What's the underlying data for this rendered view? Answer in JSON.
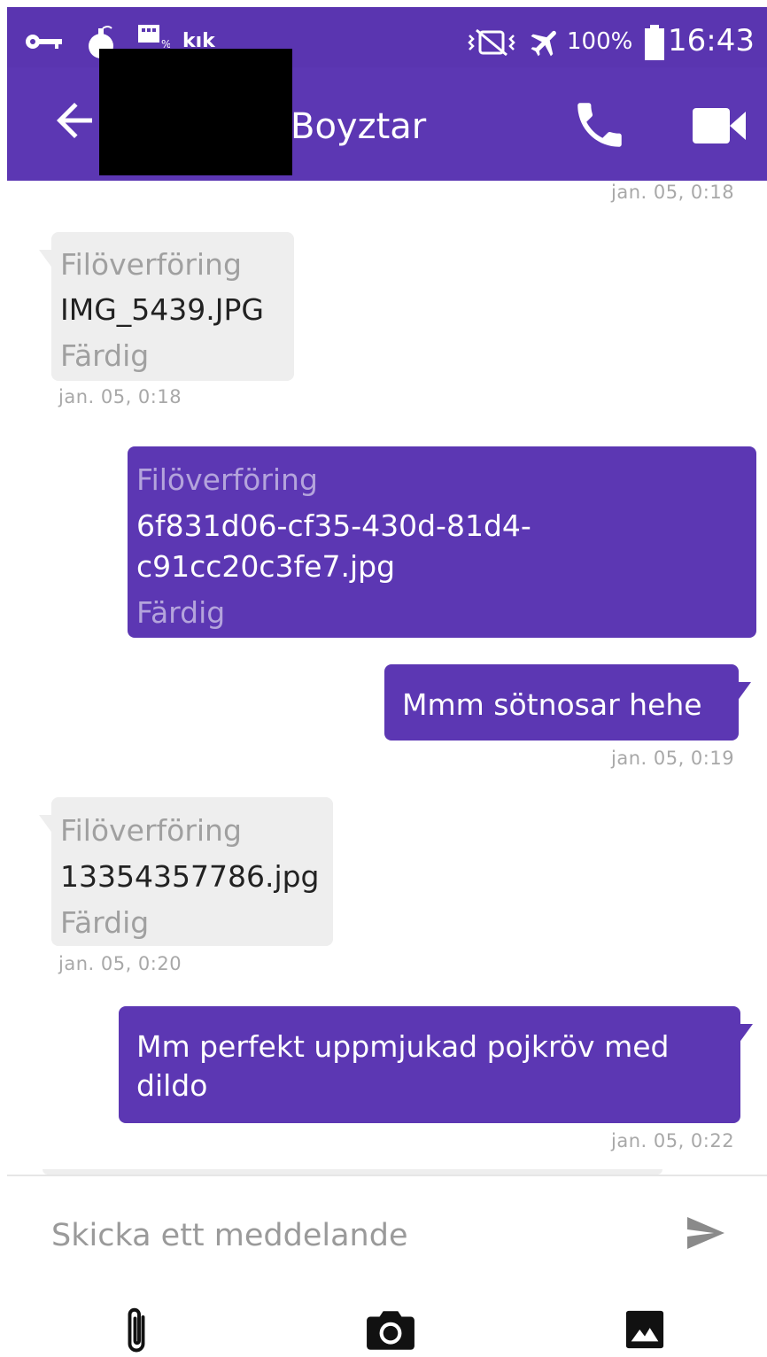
{
  "status_bar": {
    "kik_label": "kık",
    "battery_percent": "100%",
    "time": "16:43",
    "icons": [
      "key-icon",
      "bomb-icon",
      "sim-icon",
      "kik-icon",
      "vibrate-mute-icon",
      "airplane-mode-icon",
      "battery-icon"
    ]
  },
  "header": {
    "contact_name": "Boyztar",
    "back_icon": "arrow-left-icon",
    "call_icon": "phone-icon",
    "video_icon": "video-camera-icon"
  },
  "messages": [
    {
      "direction": "out",
      "timestamp": "jan. 05, 0:18"
    },
    {
      "direction": "in",
      "label": "Filöverföring",
      "file": "IMG_5439.JPG",
      "status": "Färdig",
      "timestamp": "jan. 05, 0:18"
    },
    {
      "direction": "out",
      "label": "Filöverföring",
      "file_line1": "6f831d06-cf35-430d-81d4-",
      "file_line2": "c91cc20c3fe7.jpg",
      "status": "Färdig"
    },
    {
      "direction": "out",
      "text": "Mmm sötnosar hehe",
      "timestamp": "jan. 05, 0:19"
    },
    {
      "direction": "in",
      "label": "Filöverföring",
      "file": "13354357786.jpg",
      "status": "Färdig",
      "timestamp": "jan. 05, 0:20"
    },
    {
      "direction": "out",
      "text_line1": "Mm perfekt uppmjukad pojkröv med",
      "text_line2": "dildo",
      "timestamp": "jan. 05, 0:22"
    }
  ],
  "compose": {
    "placeholder": "Skicka ett meddelande",
    "value": "",
    "send_icon": "send-icon",
    "attach_icon": "paperclip-icon",
    "camera_icon": "camera-icon",
    "gallery_icon": "image-gallery-icon"
  },
  "colors": {
    "accent": "#5c37b3",
    "incoming_bubble": "#eeeeee",
    "timestamp": "#a8a8a8"
  }
}
